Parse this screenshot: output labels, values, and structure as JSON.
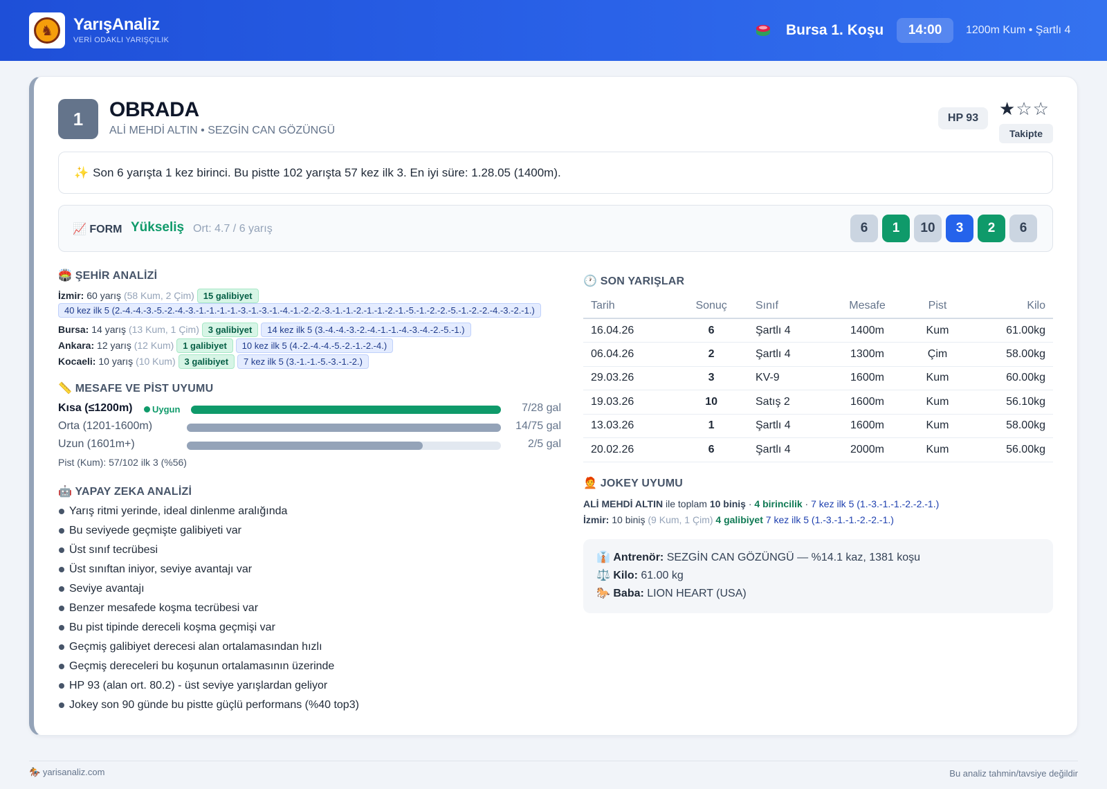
{
  "header": {
    "brand_title": "YarışAnaliz",
    "brand_subtitle": "VERİ ODAKLI YARIŞÇILIK",
    "race_title": "Bursa 1. Koşu",
    "race_time": "14:00",
    "race_meta": "1200m Kum • Şartlı 4"
  },
  "horse": {
    "number": "1",
    "name": "OBRADA",
    "subtitle": "ALİ MEHDİ ALTIN • SEZGİN CAN GÖZÜNGÜ",
    "hp": "HP 93",
    "stars_filled": "★",
    "stars_empty": "☆☆",
    "rating": 1,
    "follow_label": "Takipte"
  },
  "summary": {
    "icon": "✨",
    "text": "Son 6 yarışta 1 kez birinci. Bu pistte 102 yarışta 57 kez ilk 3. En iyi süre: 1.28.05 (1400m)."
  },
  "form": {
    "icon": "📈",
    "label": "FORM",
    "trend": "Yükseliş",
    "average": "Ort: 4.7 / 6 yarış",
    "results": [
      {
        "value": "6",
        "color": "gray"
      },
      {
        "value": "1",
        "color": "green"
      },
      {
        "value": "10",
        "color": "gray"
      },
      {
        "value": "3",
        "color": "blue"
      },
      {
        "value": "2",
        "color": "green"
      },
      {
        "value": "6",
        "color": "gray"
      }
    ]
  },
  "city_analysis": {
    "title": "🏟️ ŞEHİR ANALİZİ",
    "rows": [
      {
        "city": "İzmir:",
        "races": "60 yarış",
        "detail": "(58 Kum, 2 Çim)",
        "wins": "15 galibiyet",
        "top5": "40 kez ilk 5 (2.-4.-4.-3.-5.-2.-4.-3.-1.-1.-1.-1.-3.-1.-3.-1.-4.-1.-2.-2.-3.-1.-1.-2.-1.-1.-2.-1.-5.-1.-2.-2.-5.-1.-2.-2.-4.-3.-2.-1.)"
      },
      {
        "city": "Bursa:",
        "races": "14 yarış",
        "detail": "(13 Kum, 1 Çim)",
        "wins": "3 galibiyet",
        "top5": "14 kez ilk 5 (3.-4.-4.-3.-2.-4.-1.-1.-4.-3.-4.-2.-5.-1.)"
      },
      {
        "city": "Ankara:",
        "races": "12 yarış",
        "detail": "(12 Kum)",
        "wins": "1 galibiyet",
        "top5": "10 kez ilk 5 (4.-2.-4.-4.-5.-2.-1.-2.-4.)"
      },
      {
        "city": "Kocaeli:",
        "races": "10 yarış",
        "detail": "(10 Kum)",
        "wins": "3 galibiyet",
        "top5": "7 kez ilk 5 (3.-1.-1.-5.-3.-1.-2.)"
      }
    ]
  },
  "distance": {
    "title": "📏 MESAFE VE PİST UYUMU",
    "ok_label": "Uygun",
    "rows": [
      {
        "label": "Kısa (≤1200m)",
        "value": "7/28 gal",
        "fill": 1.0,
        "color": "#0f9a6a"
      },
      {
        "label": "Orta (1201-1600m)",
        "value": "14/75 gal",
        "fill": 1.0,
        "color": "#94a3b8"
      },
      {
        "label": "Uzun (1601m+)",
        "value": "2/5 gal",
        "fill": 0.75,
        "color": "#94a3b8"
      }
    ],
    "pist": "Pist (Kum): 57/102 ilk 3 (%56)"
  },
  "ai": {
    "title": "🤖 YAPAY ZEKA ANALİZİ",
    "items": [
      "Yarış ritmi yerinde, ideal dinlenme aralığında",
      "Bu seviyede geçmişte galibiyeti var",
      "Üst sınıf tecrübesi",
      "Üst sınıftan iniyor, seviye avantajı var",
      "Seviye avantajı",
      "Benzer mesafede koşma tecrübesi var",
      "Bu pist tipinde dereceli koşma geçmişi var",
      "Geçmiş galibiyet derecesi alan ortalamasından hızlı",
      "Geçmiş dereceleri bu koşunun ortalamasının üzerinde",
      "HP 93 (alan ort. 80.2) - üst seviye yarışlardan geliyor",
      "Jokey son 90 günde bu pistte güçlü performans (%40 top3)"
    ]
  },
  "recent": {
    "title": "🕐 SON YARIŞLAR",
    "columns": [
      "Tarih",
      "Sonuç",
      "Sınıf",
      "Mesafe",
      "Pist",
      "Kilo"
    ],
    "rows": [
      {
        "date": "16.04.26",
        "result": "6",
        "class": "Şartlı 4",
        "distance": "1400m",
        "track": "Kum",
        "weight": "61.00kg"
      },
      {
        "date": "06.04.26",
        "result": "2",
        "class": "Şartlı 4",
        "distance": "1300m",
        "track": "Çim",
        "weight": "58.00kg"
      },
      {
        "date": "29.03.26",
        "result": "3",
        "class": "KV-9",
        "distance": "1600m",
        "track": "Kum",
        "weight": "60.00kg"
      },
      {
        "date": "19.03.26",
        "result": "10",
        "class": "Satış 2",
        "distance": "1600m",
        "track": "Kum",
        "weight": "56.10kg"
      },
      {
        "date": "13.03.26",
        "result": "1",
        "class": "Şartlı 4",
        "distance": "1600m",
        "track": "Kum",
        "weight": "58.00kg"
      },
      {
        "date": "20.02.26",
        "result": "6",
        "class": "Şartlı 4",
        "distance": "2000m",
        "track": "Kum",
        "weight": "56.00kg"
      }
    ]
  },
  "jockey": {
    "title": "🧑‍🦰 JOKEY UYUMU",
    "name": "ALİ MEHDİ ALTIN",
    "with_total": "ile toplam",
    "rides": "10 biniş",
    "sep": "·",
    "wins": "4 birincilik",
    "top5": "7 kez ilk 5 (1.-3.-1.-1.-2.-2.-1.)",
    "city": "İzmir:",
    "city_rides": "10 biniş",
    "city_detail": "(9 Kum, 1 Çim)",
    "city_wins": "4 galibiyet",
    "city_top5": "7 kez ilk 5 (1.-3.-1.-1.-2.-2.-1.)"
  },
  "info": {
    "trainer_icon": "👔",
    "trainer_label": "Antrenör:",
    "trainer_value": "SEZGİN CAN GÖZÜNGÜ — %14.1 kaz, 1381 koşu",
    "weight_icon": "⚖️",
    "weight_label": "Kilo:",
    "weight_value": "61.00 kg",
    "sire_icon": "🐎",
    "sire_label": "Baba:",
    "sire_value": "LION HEART (USA)"
  },
  "footer": {
    "site": "yarisanaliz.com",
    "disclaimer": "Bu analiz tahmin/tavsiye değildir"
  }
}
